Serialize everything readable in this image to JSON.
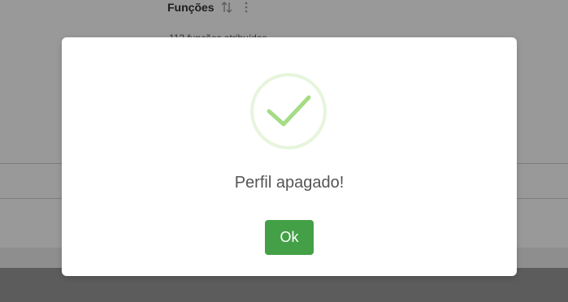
{
  "background": {
    "column_header": "Funções",
    "row_text": "113 funções atribuídas"
  },
  "dialog": {
    "icon": "success-check-icon",
    "title": "Perfil apagado!",
    "ok_label": "Ok"
  },
  "colors": {
    "overlay": "rgba(0,0,0,0.4)",
    "success_ring": "#e6f5dc",
    "success_check": "#a5dc86",
    "confirm_button": "#43a047",
    "title_text": "#545454"
  }
}
